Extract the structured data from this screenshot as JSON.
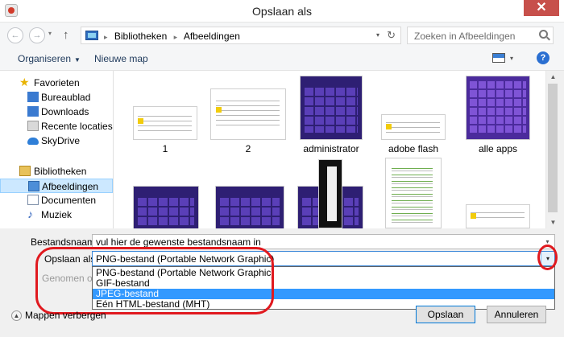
{
  "window": {
    "title": "Opslaan als",
    "close_glyph": "✕"
  },
  "nav": {
    "back_glyph": "←",
    "forward_glyph": "→",
    "dropdown_glyph": "▾",
    "up_glyph": "↑"
  },
  "address": {
    "crumbs": [
      "Bibliotheken",
      "Afbeeldingen"
    ],
    "separator": "▸",
    "dropdown_glyph": "▾",
    "refresh_glyph": "↻"
  },
  "search": {
    "placeholder": "Zoeken in Afbeeldingen"
  },
  "toolbar": {
    "organize_label": "Organiseren",
    "organize_caret": "▼",
    "new_folder_label": "Nieuwe map",
    "view_dropdown_glyph": "▾",
    "help_glyph": "?"
  },
  "sidebar": {
    "favorites_header": "Favorieten",
    "favorites": [
      "Bureaublad",
      "Downloads",
      "Recente locaties",
      "SkyDrive"
    ],
    "libraries_header": "Bibliotheken",
    "libraries": [
      "Afbeeldingen",
      "Documenten",
      "Muziek"
    ],
    "star_glyph": "★",
    "music_glyph": "♪"
  },
  "files": [
    "1",
    "2",
    "administrator",
    "adobe flash",
    "alle apps"
  ],
  "scrollbar": {
    "up_glyph": "▲",
    "down_glyph": "▼"
  },
  "form": {
    "filename_label": "Bestandsnaam:",
    "filename_value": "vul hier de gewenste bestandsnaam in",
    "savetype_label": "Opslaan als:",
    "savetype_value": "PNG-bestand (Portable Network Graphic)",
    "taken_label": "Genomen op:",
    "dropdown_glyph": "▾"
  },
  "savetype_options": [
    "PNG-bestand (Portable Network Graphic)",
    "GIF-bestand",
    "JPEG-bestand",
    "Eén HTML-bestand (MHT)"
  ],
  "savetype_selected_index": 2,
  "footer": {
    "hide_folders_label": "Mappen verbergen",
    "hide_folders_glyph": "▲",
    "save_label": "Opslaan",
    "cancel_label": "Annuleren"
  },
  "colors": {
    "selection": "#3399ff",
    "annotation": "#e0191f",
    "nav_selected": "#cce8ff",
    "help": "#2a6fd1",
    "close": "#c7504b"
  }
}
